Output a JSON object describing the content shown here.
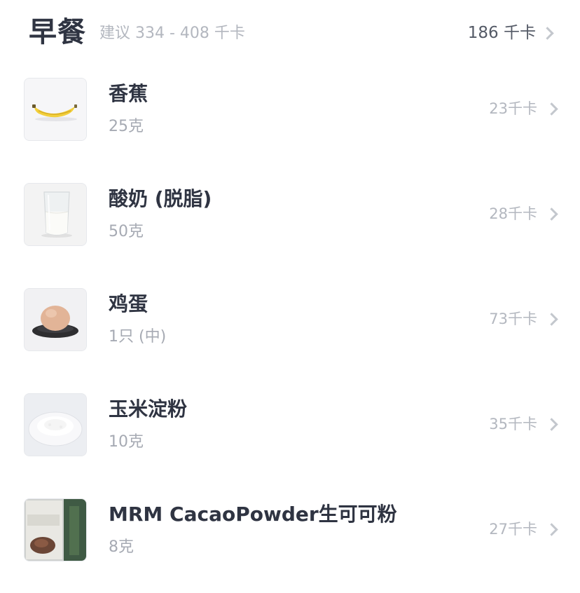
{
  "header": {
    "meal_title": "早餐",
    "suggestion": "建议 334 - 408 千卡",
    "total_kcal": "186 千卡"
  },
  "foods": [
    {
      "name": "香蕉",
      "amount": "25克",
      "kcal": "23千卡",
      "icon": "banana-image"
    },
    {
      "name": "酸奶 (脱脂)",
      "amount": "50克",
      "kcal": "28千卡",
      "icon": "yogurt-glass-image"
    },
    {
      "name": "鸡蛋",
      "amount": "1只 (中)",
      "kcal": "73千卡",
      "icon": "egg-on-plate-image"
    },
    {
      "name": "玉米淀粉",
      "amount": "10克",
      "kcal": "35千卡",
      "icon": "cornstarch-plate-image"
    },
    {
      "name": "MRM CacaoPowder生可可粉",
      "amount": "8克",
      "kcal": "27千卡",
      "icon": "cacao-powder-bag-image"
    }
  ],
  "colors": {
    "title": "#2f3442",
    "secondary": "#a6aab3",
    "chevron": "#c3c7cd"
  }
}
